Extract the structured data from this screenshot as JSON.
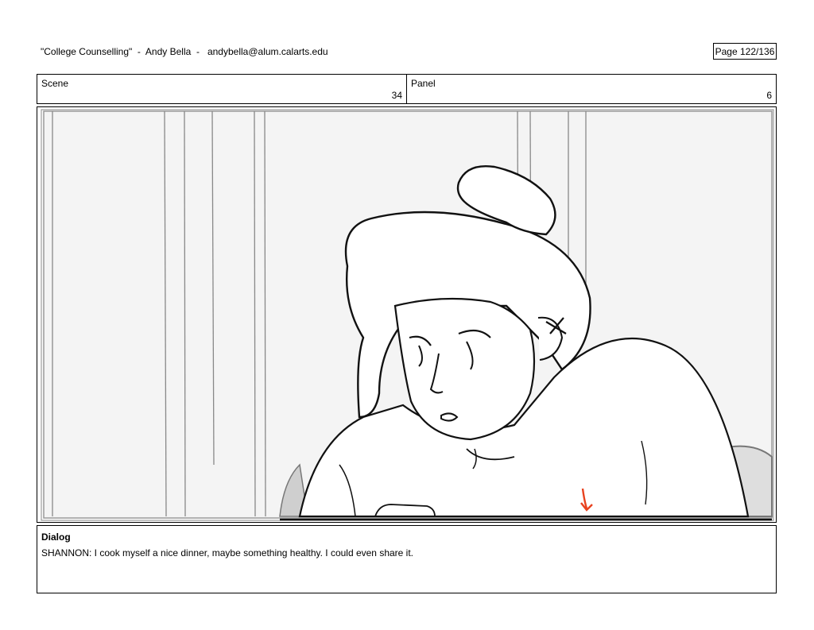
{
  "header": {
    "title": "\"College Counselling\"  -  Andy Bella  -   andybella@alum.calarts.edu",
    "page": "Page 122/136"
  },
  "scene": {
    "label": "Scene",
    "value": "34"
  },
  "panel": {
    "label": "Panel",
    "value": "6"
  },
  "dialog": {
    "label": "Dialog",
    "text": "SHANNON: I cook myself a nice dinner, maybe something healthy. I could even share it."
  },
  "colors": {
    "annotation_arrow": "#e8421f"
  }
}
